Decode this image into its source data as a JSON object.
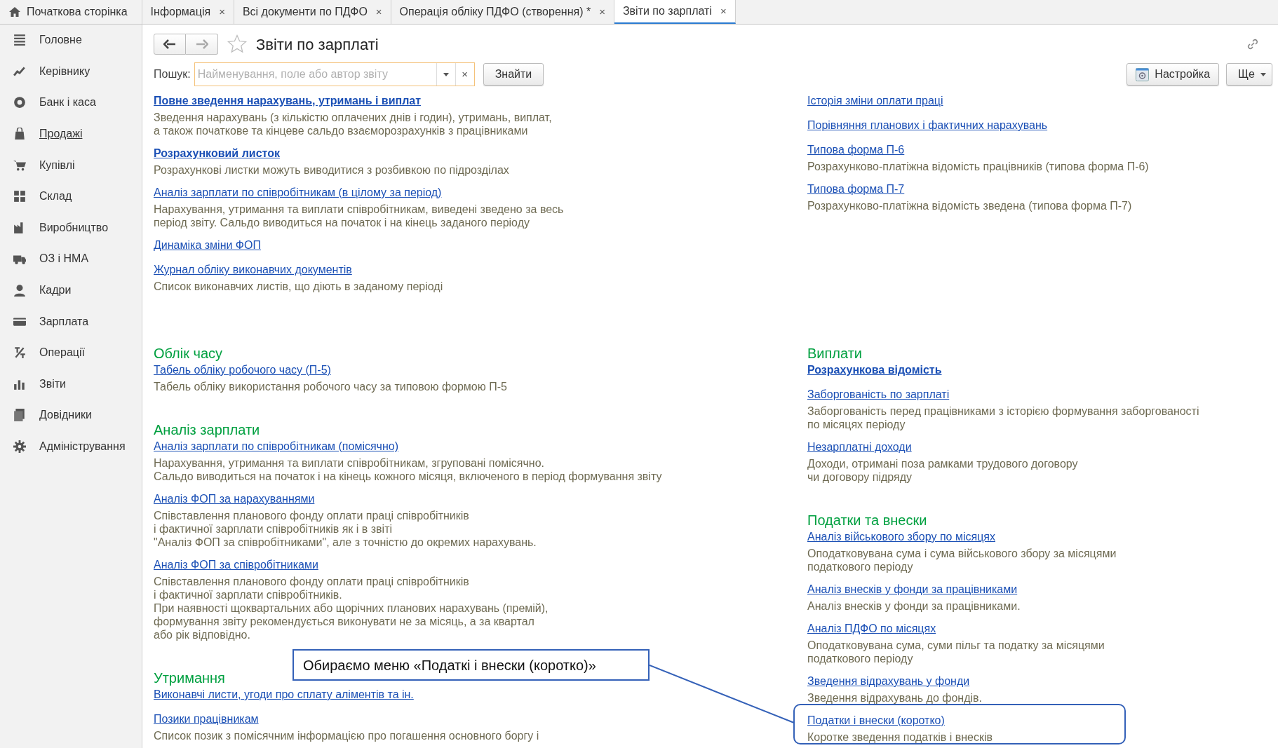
{
  "tabs": [
    {
      "label": "Початкова сторінка",
      "kind": "home",
      "selected": false
    },
    {
      "label": "Інформація",
      "kind": "doc",
      "close": "×",
      "selected": false
    },
    {
      "label": "Всі документи по ПДФО",
      "kind": "doc",
      "close": "×",
      "selected": false
    },
    {
      "label": "Операція обліку ПДФО (створення) *",
      "kind": "doc",
      "close": "×",
      "selected": false
    },
    {
      "label": "Звіти по зарплаті",
      "kind": "doc",
      "close": "×",
      "selected": true
    }
  ],
  "sidebar": {
    "items": [
      {
        "label": "Головне",
        "hovered": false
      },
      {
        "label": "Керівнику",
        "hovered": false
      },
      {
        "label": "Банк і каса",
        "hovered": false
      },
      {
        "label": "Продажі",
        "hovered": true
      },
      {
        "label": "Купівлі",
        "hovered": false
      },
      {
        "label": "Склад",
        "hovered": false
      },
      {
        "label": "Виробництво",
        "hovered": false
      },
      {
        "label": "ОЗ і НМА",
        "hovered": false
      },
      {
        "label": "Кадри",
        "hovered": false
      },
      {
        "label": "Зарплата",
        "hovered": false
      },
      {
        "label": "Операції",
        "hovered": false
      },
      {
        "label": "Звіти",
        "hovered": false
      },
      {
        "label": "Довідники",
        "hovered": false
      },
      {
        "label": "Адміністрування",
        "hovered": false
      }
    ]
  },
  "page": {
    "title": "Звіти по зарплаті",
    "search": {
      "label": "Пошук:",
      "placeholder": "Найменування, поле або автор звіту",
      "clear": "×"
    },
    "find_button": "Знайти",
    "settings_button": "Настройка",
    "more_button": "Ще"
  },
  "columns": [
    [
      {
        "items": [
          {
            "title": "Повне зведення нарахувань, утримань і виплат",
            "bold": true,
            "description": "Зведення нарахувань (з кількістю оплачених днів і годин), утримань, виплат,\nа також початкове та кінцеве сальдо взаєморозрахунків з працівниками"
          },
          {
            "title": "Розрахунковий листок",
            "bold": true,
            "description": "Розрахункові листки можуть виводитися з розбивкою по підрозділах"
          },
          {
            "title": "Аналіз зарплати по співробітникам (в цілому за період)",
            "bold": false,
            "description": "Нарахування, утримання та виплати співробітникам, виведені зведено за весь\nперіод звіту. Сальдо виводиться на початок і на кінець заданого періоду"
          },
          {
            "title": "Динаміка зміни ФОП",
            "bold": false
          },
          {
            "title": "Журнал обліку виконавчих документів",
            "bold": false,
            "description": "Список виконавчих листів, що діють в заданому періоді"
          }
        ]
      },
      {
        "heading": "Облік часу",
        "items": [
          {
            "title": "Табель обліку робочого часу (П-5)",
            "bold": false,
            "description": "Табель обліку використання робочого часу за типовою формою П-5"
          }
        ]
      },
      {
        "heading": "Аналіз зарплати",
        "items": [
          {
            "title": "Аналіз зарплати по співробітникам (помісячно)",
            "bold": false,
            "description": "Нарахування, утримання та виплати співробітникам, згруповані помісячно.\nСальдо виводиться на початок і на кінець кожного місяця, включеного в період формування звіту"
          },
          {
            "title": "Аналіз ФОП за нарахуваннями",
            "bold": false,
            "description": "Співставлення планового фонду оплати праці співробітників\nі фактичної зарплати співробітників як і в звіті\n\"Аналіз ФОП за співробітниками\", але з точністю до окремих нарахувань."
          },
          {
            "title": "Аналіз ФОП за співробітниками",
            "bold": false,
            "description": "Співставлення планового фонду оплати праці співробітників\nі фактичної зарплати співробітників.\nПри наявності щоквартальних або щорічних планових нарахувань (премій),\nформування звіту рекомендується виконувати не за місяць, а за квартал\nабо рік відповідно."
          }
        ]
      },
      {
        "heading": "Утримання",
        "items": [
          {
            "title": "Виконавчі листи, угоди про сплату аліментів та ін.",
            "bold": false
          },
          {
            "title": "Позики працівникам",
            "bold": false,
            "description": "Список позик з помісячним інформацією про погашення основного боргу і"
          }
        ]
      }
    ],
    [
      {
        "items": [
          {
            "title": "Історія зміни оплати праці",
            "bold": false
          },
          {
            "title": "Порівняння планових і фактичних нарахувань",
            "bold": false
          },
          {
            "title": "Типова форма П-6",
            "bold": false,
            "description": "Розрахунково-платіжна відомість працівників (типова форма П-6)"
          },
          {
            "title": "Типова форма П-7",
            "bold": false,
            "description": "Розрахунково-платіжна відомість зведена (типова форма П-7)"
          }
        ]
      },
      {
        "heading": "Виплати",
        "items": [
          {
            "title": "Розрахункова відомість",
            "bold": true
          },
          {
            "title": "Заборгованість по зарплаті",
            "bold": false,
            "description": "Заборгованість перед працівниками з історією формування заборгованості\nпо місяцях періоду"
          },
          {
            "title": "Незарплатні доходи",
            "bold": false,
            "description": "Доходи, отримані поза рамками трудового договору\nчи договору підряду"
          }
        ]
      },
      {
        "heading": "Податки та внески",
        "items": [
          {
            "title": "Аналіз військового збору по місяцях",
            "bold": false,
            "description": "Оподатковувана сума і сума військового збору за місяцями\nподаткового періоду"
          },
          {
            "title": "Аналіз внесків у фонди за працівниками",
            "bold": false,
            "description": "Аналіз внесків у фонди за працівниками."
          },
          {
            "title": "Аналіз ПДФО по місяцях",
            "bold": false,
            "description": "Оподатковувана сума, суми пільг та податку за місяцями\nподаткового періоду"
          },
          {
            "title": "Зведення відрахувань у фонди",
            "bold": false,
            "description": "Зведення відрахувань до фондів."
          },
          {
            "title": "Податки і внески (коротко)",
            "bold": false,
            "description": "Коротке зведення податків і внесків"
          }
        ]
      }
    ]
  ],
  "callout": {
    "text": "Обираємо меню «Податкі і внески (коротко)»"
  }
}
